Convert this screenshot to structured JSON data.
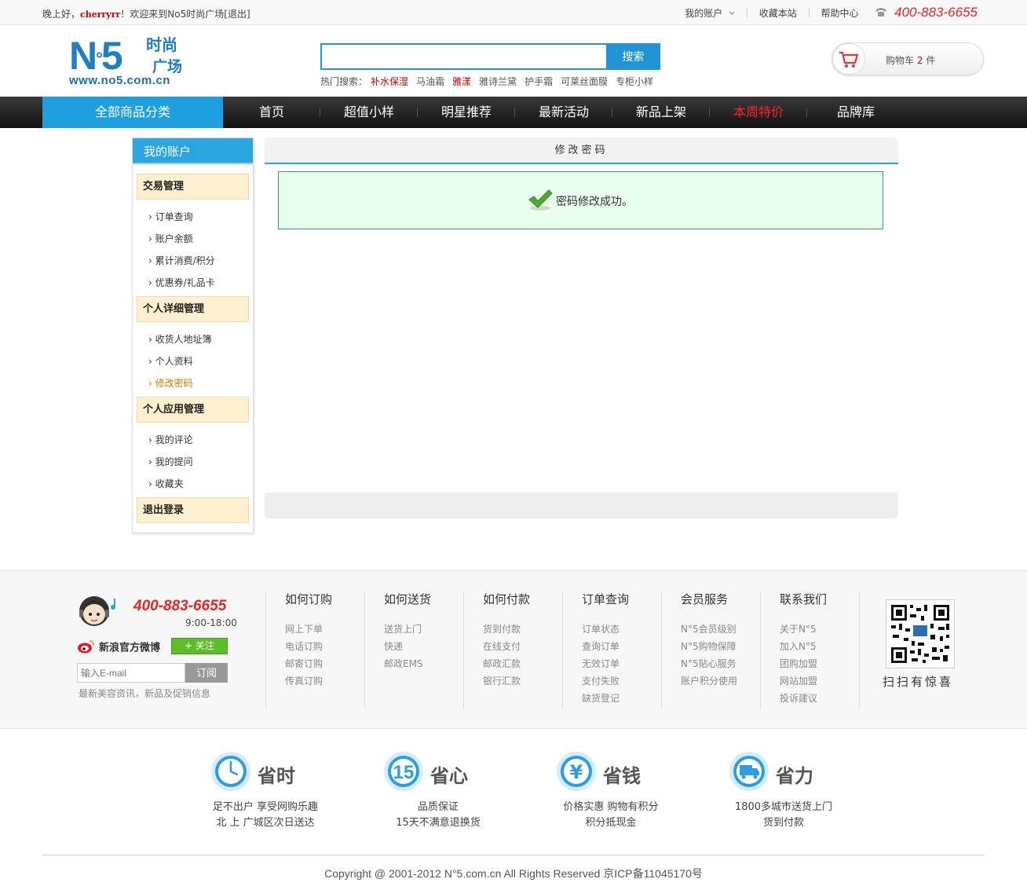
{
  "topbar": {
    "greeting": "晚上好，",
    "username": "cherryrr",
    "welcome": "！欢迎来到No5时尚广场",
    "logout": "[退出]",
    "my_account": "我的账户",
    "bookmark": "收藏本站",
    "help": "帮助中心",
    "phone": "400-883-6655"
  },
  "logo": {
    "brand": "N",
    "sup": "°",
    "five": "5",
    "tag1": "时尚",
    "tag2": "广场",
    "url": "www.no5.com.cn"
  },
  "search": {
    "placeholder": "",
    "button": "搜索",
    "hot_label": "热门搜索：",
    "hot_terms": [
      "补水保湿",
      "马油霜",
      "雅漾",
      "雅诗兰黛",
      "护手霜",
      "可莱丝面膜",
      "专柜小样"
    ]
  },
  "cart": {
    "label": "购物车",
    "count": "2",
    "unit": "件"
  },
  "nav": {
    "all": "全部商品分类",
    "items": [
      "首页",
      "超值小样",
      "明星推荐",
      "最新活动",
      "新品上架",
      "本周特价",
      "品牌库"
    ]
  },
  "sidebar": {
    "title": "我的账户",
    "groups": [
      {
        "title": "交易管理",
        "links": [
          "订单查询",
          "账户余额",
          "累计消费/积分",
          "优惠券/礼品卡"
        ]
      },
      {
        "title": "个人详细管理",
        "links": [
          "收货人地址簿",
          "个人资料",
          "修改密码"
        ]
      },
      {
        "title": "个人应用管理",
        "links": [
          "我的评论",
          "我的提问",
          "收藏夹"
        ]
      },
      {
        "title": "退出登录",
        "links": []
      }
    ]
  },
  "main": {
    "title": "修改密码",
    "message": "密码修改成功。"
  },
  "footer": {
    "phone": "400-883-6655",
    "hours": "9:00-18:00",
    "weibo": "新浪官方微博",
    "follow": "+ 关注",
    "email_placeholder": "输入E-mail",
    "subscribe": "订阅",
    "email_tip": "最新美容资讯，新品及促销信息",
    "columns": [
      {
        "title": "如何订购",
        "links": [
          "网上下单",
          "电话订购",
          "邮寄订购",
          "传真订购"
        ]
      },
      {
        "title": "如何送货",
        "links": [
          "送货上门",
          "快递",
          "邮政EMS"
        ]
      },
      {
        "title": "如何付款",
        "links": [
          "货到付款",
          "在线支付",
          "邮政汇款",
          "银行汇款"
        ]
      },
      {
        "title": "订单查询",
        "links": [
          "订单状态",
          "查询订单",
          "无效订单",
          "支付失败",
          "缺货登记"
        ]
      },
      {
        "title": "会员服务",
        "links": [
          "N°5会员级别",
          "N°5购物保障",
          "N°5贴心服务",
          "账户积分使用"
        ]
      },
      {
        "title": "联系我们",
        "links": [
          "关于N°5",
          "加入N°5",
          "团购加盟",
          "网站加盟",
          "投诉建议"
        ]
      }
    ],
    "qr_tip": "扫扫有惊喜"
  },
  "promos": [
    {
      "title": "省时",
      "line1": "足不出户 享受网购乐趣",
      "line2": "北 上 广城区次日送达",
      "icon": "clock-icon"
    },
    {
      "title": "省心",
      "line1": "品质保证",
      "line2": "15天不满意退换货",
      "icon": "fifteen-icon"
    },
    {
      "title": "省钱",
      "line1": "价格实惠 购物有积分",
      "line2": "积分抵现金",
      "icon": "yen-icon"
    },
    {
      "title": "省力",
      "line1": "1800多城市送货上门",
      "line2": "货到付款",
      "icon": "truck-icon"
    }
  ],
  "copyright": "Copyright @ 2001-2012 N°5.com.cn All Rights Reserved 京ICP备11045170号",
  "colors": {
    "accent": "#1ea0e0",
    "price_red": "#ee2222",
    "success_bg": "#e8fdee",
    "group_bg": "#fcf0cf"
  }
}
